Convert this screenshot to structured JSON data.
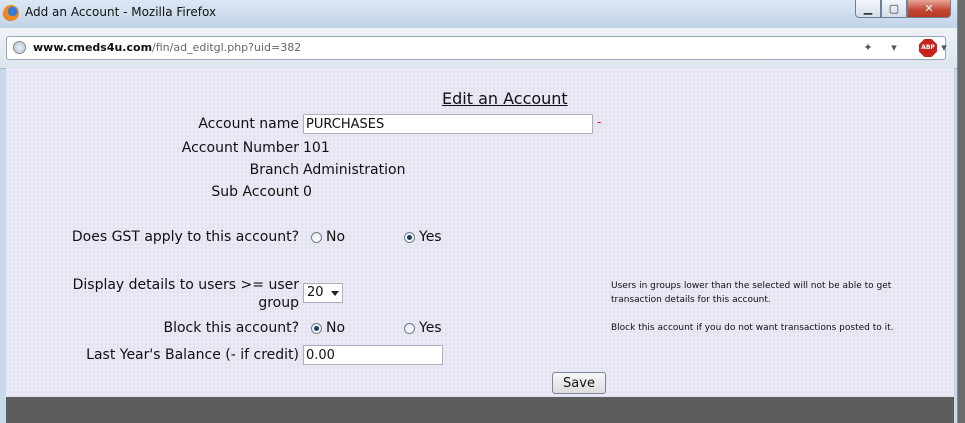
{
  "window": {
    "title": "Add an Account - Mozilla Firefox",
    "min_glyph": "▁",
    "max_glyph": "▢",
    "close_glyph": "✕"
  },
  "address": {
    "url_domain": "www.cmeds4u.com",
    "url_path": "/fin/ad_editgl.php?uid=382",
    "abp_label": "ABP"
  },
  "form": {
    "title": "Edit an Account",
    "account_name_label": "Account name",
    "account_name_value": "PURCHASES",
    "required_mark": "-",
    "account_number_label": "Account Number",
    "account_number_value": "101",
    "branch_label": "Branch",
    "branch_value": "Administration",
    "sub_account_label": "Sub Account",
    "sub_account_value": "0",
    "gst_label": "Does GST apply to this account?",
    "gst_no_label": "No",
    "gst_yes_label": "Yes",
    "gst_selected": "Yes",
    "display_label_line1": "Display details to users >= user",
    "display_label_line2": "group",
    "display_value": "20",
    "display_note_line1": "Users in groups lower than the selected will not be able to get",
    "display_note_line2": "transaction details for this account.",
    "block_label": "Block this account?",
    "block_no_label": "No",
    "block_yes_label": "Yes",
    "block_selected": "No",
    "block_note": "Block this account if you do not want transactions posted to it.",
    "balance_label": "Last Year's Balance (- if credit)",
    "balance_value": "0.00",
    "save_label": "Save"
  }
}
